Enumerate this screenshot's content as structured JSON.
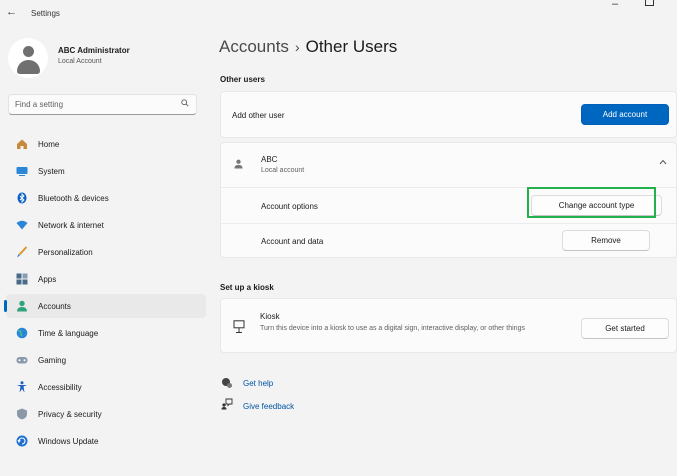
{
  "window": {
    "title": "Settings"
  },
  "profile": {
    "name": "ABC Administrator",
    "subtitle": "Local Account"
  },
  "search": {
    "placeholder": "Find a setting"
  },
  "sidebar": {
    "items": [
      {
        "label": "Home",
        "icon": "home-icon"
      },
      {
        "label": "System",
        "icon": "system-icon"
      },
      {
        "label": "Bluetooth & devices",
        "icon": "bluetooth-icon"
      },
      {
        "label": "Network & internet",
        "icon": "wifi-icon"
      },
      {
        "label": "Personalization",
        "icon": "brush-icon"
      },
      {
        "label": "Apps",
        "icon": "apps-icon"
      },
      {
        "label": "Accounts",
        "icon": "accounts-icon",
        "active": true
      },
      {
        "label": "Time & language",
        "icon": "globe-icon"
      },
      {
        "label": "Gaming",
        "icon": "gamepad-icon"
      },
      {
        "label": "Accessibility",
        "icon": "accessibility-icon"
      },
      {
        "label": "Privacy & security",
        "icon": "shield-icon"
      },
      {
        "label": "Windows Update",
        "icon": "update-icon"
      }
    ]
  },
  "breadcrumb": {
    "root": "Accounts",
    "separator": "›",
    "current": "Other Users"
  },
  "other_users": {
    "section_title": "Other users",
    "add_label": "Add other user",
    "add_button": "Add account",
    "user": {
      "name": "ABC",
      "type": "Local account",
      "options_label": "Account options",
      "change_button": "Change account type",
      "data_label": "Account and data",
      "remove_button": "Remove"
    }
  },
  "kiosk": {
    "section_title": "Set up a kiosk",
    "title": "Kiosk",
    "description": "Turn this device into a kiosk to use as a digital sign, interactive display, or other things",
    "button": "Get started"
  },
  "links": {
    "help": "Get help",
    "feedback": "Give feedback"
  },
  "colors": {
    "accent": "#0067c0",
    "highlight": "#22b14c"
  }
}
